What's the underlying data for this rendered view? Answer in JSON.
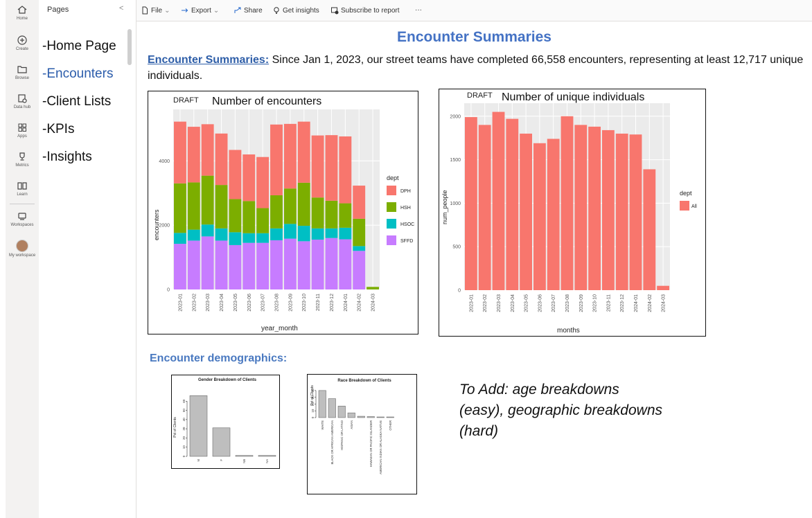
{
  "rail": [
    {
      "label": "Home",
      "icon": "home-icon"
    },
    {
      "label": "Create",
      "icon": "plus-circle-icon"
    },
    {
      "label": "Browse",
      "icon": "folder-icon"
    },
    {
      "label": "Data hub",
      "icon": "data-hub-icon"
    },
    {
      "label": "Apps",
      "icon": "apps-icon"
    },
    {
      "label": "Metrics",
      "icon": "trophy-icon"
    },
    {
      "label": "Learn",
      "icon": "book-icon"
    },
    {
      "label": "Workspaces",
      "icon": "workspaces-icon"
    },
    {
      "label": "My workspace",
      "icon": "avatar"
    }
  ],
  "pages": {
    "heading": "Pages",
    "collapse": "<",
    "items": [
      "-Home Page",
      "-Encounters",
      "-Client Lists",
      "-KPIs",
      "-Insights"
    ],
    "active_index": 1
  },
  "toolbar": {
    "file": "File",
    "export": "Export",
    "share": "Share",
    "insights": "Get insights",
    "subscribe": "Subscribe to report",
    "more": "···"
  },
  "report": {
    "title": "Encounter Summaries",
    "intro_label": "Encounter Summaries:",
    "intro_text": " Since Jan 1, 2023, our street teams have completed 66,558 encounters, representing at least 12,717 unique individuals.",
    "demographics_title": "Encounter demographics:",
    "todo": "To Add: age breakdowns (easy), geographic breakdowns (hard)"
  },
  "chart_data": [
    {
      "type": "bar",
      "stacked": true,
      "draft_label": "DRAFT",
      "title": "Number of encounters",
      "xlabel": "year_month",
      "ylabel": "encounters",
      "ylim": [
        0,
        5600
      ],
      "yticks": [
        0,
        2000,
        4000
      ],
      "categories": [
        "2023-01",
        "2023-02",
        "2023-03",
        "2023-04",
        "2023-05",
        "2023-06",
        "2023-07",
        "2023-08",
        "2023-09",
        "2023-10",
        "2023-11",
        "2023-12",
        "2024-01",
        "2024-02",
        "2024-03"
      ],
      "legend_title": "dept",
      "series": [
        {
          "name": "SFFD",
          "color": "#c77cff",
          "values": [
            1420,
            1520,
            1650,
            1520,
            1380,
            1450,
            1450,
            1530,
            1580,
            1500,
            1550,
            1600,
            1560,
            1200,
            0
          ]
        },
        {
          "name": "HSOC",
          "color": "#00bfc4",
          "values": [
            340,
            340,
            370,
            380,
            400,
            300,
            300,
            370,
            460,
            480,
            350,
            300,
            360,
            150,
            0
          ]
        },
        {
          "name": "HSH",
          "color": "#7cae00",
          "values": [
            1540,
            1470,
            1520,
            1350,
            1030,
            1000,
            780,
            1030,
            1100,
            1340,
            960,
            860,
            760,
            850,
            80
          ]
        },
        {
          "name": "DPH",
          "color": "#f8766d",
          "values": [
            1920,
            1730,
            1600,
            1600,
            1530,
            1450,
            1590,
            2200,
            2010,
            1900,
            1930,
            2040,
            2080,
            1030,
            0
          ]
        }
      ]
    },
    {
      "type": "bar",
      "draft_label": "DRAFT",
      "title": "Number of unique individuals encountered",
      "xlabel": "months",
      "ylabel": "num_people",
      "ylim": [
        0,
        2150
      ],
      "yticks": [
        0,
        500,
        1000,
        1500,
        2000
      ],
      "categories": [
        "2023-01",
        "2023-02",
        "2023-03",
        "2023-04",
        "2023-05",
        "2023-06",
        "2023-07",
        "2023-08",
        "2023-09",
        "2023-10",
        "2023-11",
        "2023-12",
        "2024-01",
        "2024-02",
        "2024-03"
      ],
      "legend_title": "dept",
      "series": [
        {
          "name": "All",
          "color": "#f8766d",
          "values": [
            1990,
            1900,
            2050,
            1970,
            1800,
            1690,
            1740,
            2000,
            1900,
            1880,
            1840,
            1800,
            1790,
            1390,
            50
          ]
        }
      ]
    },
    {
      "type": "bar",
      "title": "Gender Breakdown of Clients",
      "ylabel": "Pct of Clients",
      "ylim": [
        0,
        70
      ],
      "yticks": [
        0,
        10,
        20,
        30,
        40,
        50,
        60
      ],
      "categories": [
        "M",
        "F",
        "NB",
        "NA"
      ],
      "values": [
        66,
        31,
        1,
        1
      ]
    },
    {
      "type": "bar",
      "title": "Race Breakdown of Clients",
      "ylabel": "Pct of Clients",
      "ylim": [
        0,
        45
      ],
      "yticks": [
        0,
        10,
        20,
        30,
        40
      ],
      "categories": [
        "WHITE",
        "BLACK OR AFRICAN AMERICAN",
        "HISPANIC OR LATINO",
        "ASIAN",
        "",
        "HAWAIIAN OR PACIFIC ISLANDER",
        "AMERICAN INDIAN OR ALASKA NATIVE",
        "OTHER"
      ],
      "values": [
        40,
        28,
        17,
        7,
        2,
        1.5,
        1,
        1
      ]
    }
  ]
}
